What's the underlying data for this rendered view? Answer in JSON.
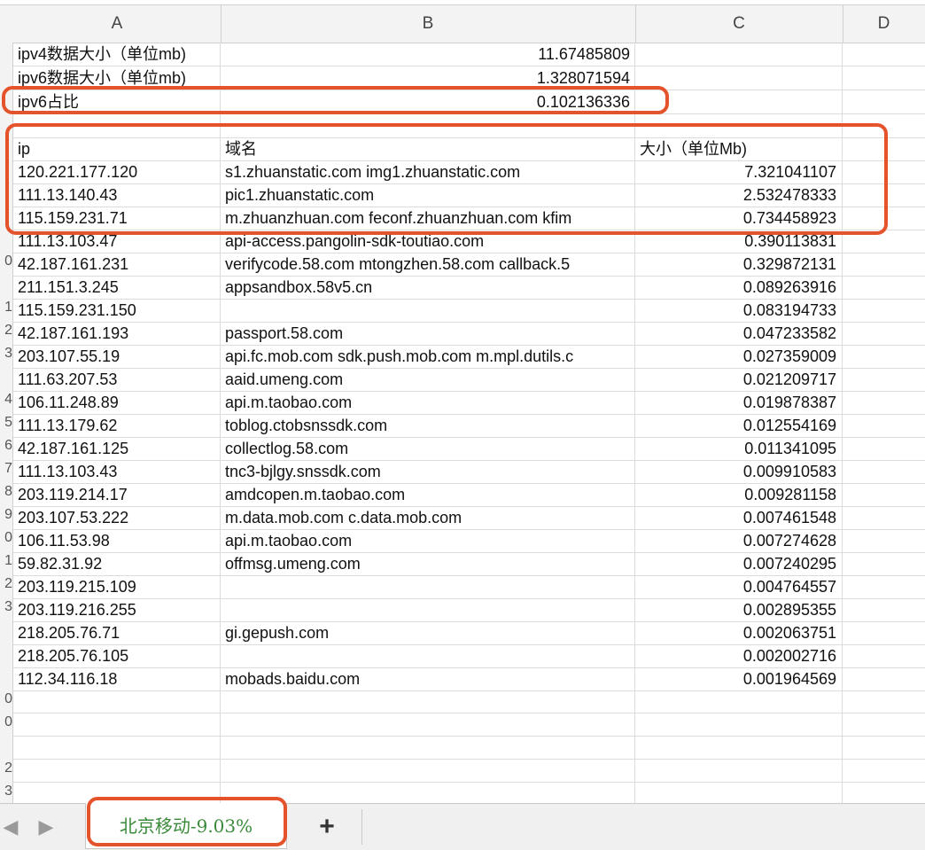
{
  "columns": [
    "A",
    "B",
    "C",
    "D"
  ],
  "summary": [
    {
      "label": "ipv4数据大小（单位mb)",
      "value": "11.67485809"
    },
    {
      "label": "ipv6数据大小（单位mb)",
      "value": "1.328071594"
    },
    {
      "label": "ipv6占比",
      "value": "0.102136336"
    }
  ],
  "table": {
    "headers": {
      "ip": "ip",
      "domain": "域名",
      "size": "大小（单位Mb)"
    },
    "rows": [
      {
        "ip": "120.221.177.120",
        "domain": "s1.zhuanstatic.com  img1.zhuanstatic.com",
        "size": "7.321041107"
      },
      {
        "ip": "111.13.140.43",
        "domain": "pic1.zhuanstatic.com",
        "size": "2.532478333"
      },
      {
        "ip": "115.159.231.71",
        "domain": "m.zhuanzhuan.com  feconf.zhuanzhuan.com  kfim",
        "size": "0.734458923"
      },
      {
        "ip": "111.13.103.47",
        "domain": "api-access.pangolin-sdk-toutiao.com",
        "size": "0.390113831"
      },
      {
        "ip": "42.187.161.231",
        "domain": "verifycode.58.com  mtongzhen.58.com  callback.5",
        "size": "0.329872131"
      },
      {
        "ip": "211.151.3.245",
        "domain": "appsandbox.58v5.cn",
        "size": "0.089263916"
      },
      {
        "ip": "115.159.231.150",
        "domain": "",
        "size": "0.083194733"
      },
      {
        "ip": "42.187.161.193",
        "domain": "passport.58.com",
        "size": "0.047233582"
      },
      {
        "ip": "203.107.55.19",
        "domain": "api.fc.mob.com  sdk.push.mob.com  m.mpl.dutils.c",
        "size": "0.027359009"
      },
      {
        "ip": "111.63.207.53",
        "domain": "aaid.umeng.com",
        "size": "0.021209717"
      },
      {
        "ip": "106.11.248.89",
        "domain": "api.m.taobao.com",
        "size": "0.019878387"
      },
      {
        "ip": "111.13.179.62",
        "domain": "toblog.ctobsnssdk.com",
        "size": "0.012554169"
      },
      {
        "ip": "42.187.161.125",
        "domain": "collectlog.58.com",
        "size": "0.011341095"
      },
      {
        "ip": "111.13.103.43",
        "domain": "tnc3-bjlgy.snssdk.com",
        "size": "0.009910583"
      },
      {
        "ip": "203.119.214.17",
        "domain": "amdcopen.m.taobao.com",
        "size": "0.009281158"
      },
      {
        "ip": "203.107.53.222",
        "domain": "m.data.mob.com  c.data.mob.com",
        "size": "0.007461548"
      },
      {
        "ip": "106.11.53.98",
        "domain": "api.m.taobao.com",
        "size": "0.007274628"
      },
      {
        "ip": "59.82.31.92",
        "domain": "offmsg.umeng.com",
        "size": "0.007240295"
      },
      {
        "ip": "203.119.215.109",
        "domain": "",
        "size": "0.004764557"
      },
      {
        "ip": "203.119.216.255",
        "domain": "",
        "size": "0.002895355"
      },
      {
        "ip": "218.205.76.71",
        "domain": "gi.gepush.com",
        "size": "0.002063751"
      },
      {
        "ip": "218.205.76.105",
        "domain": "",
        "size": "0.002002716"
      },
      {
        "ip": "112.34.116.18",
        "domain": "mobads.baidu.com",
        "size": "0.001964569"
      }
    ]
  },
  "row_numbers": [
    "0",
    "1",
    "2",
    "3",
    "4",
    "5",
    "6",
    "7",
    "8",
    "9",
    "0",
    "1",
    "2",
    "3",
    "0",
    "0",
    "2",
    "3"
  ],
  "sheet_tab": {
    "label": "北京移动-9.03%"
  },
  "add_tab": {
    "label": "+"
  },
  "icons": {
    "prev": "triangle-left-icon",
    "next": "triangle-right-icon"
  },
  "colors": {
    "highlight": "#e4532b",
    "tab_text": "#3a8a3a"
  }
}
